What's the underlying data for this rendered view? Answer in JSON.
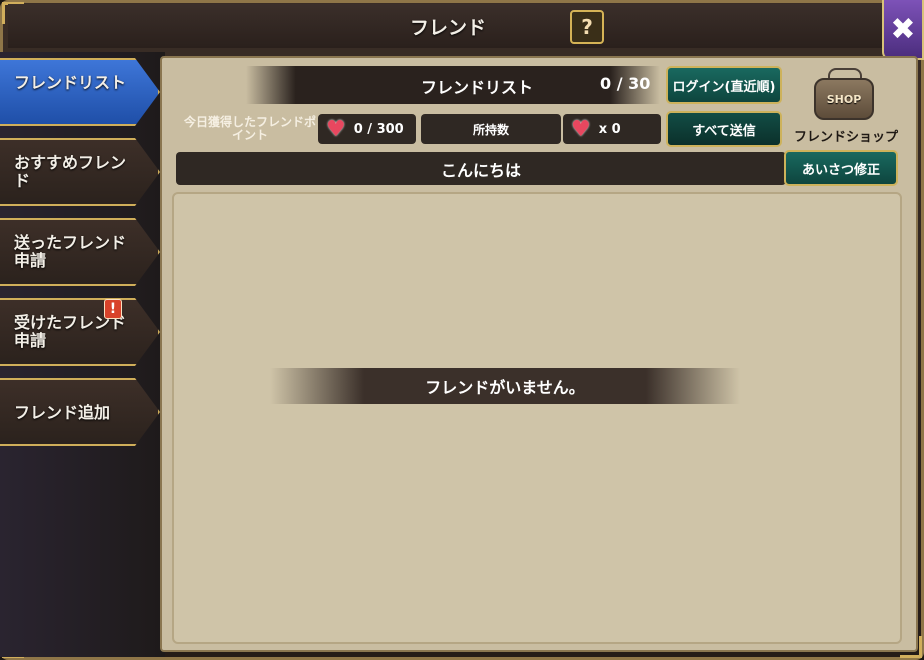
{
  "header": {
    "title": "フレンド",
    "help_label": "?",
    "close_label": "✖"
  },
  "sidebar": {
    "tabs": [
      {
        "label": "フレンドリスト",
        "active": true
      },
      {
        "label": "おすすめフレンド",
        "active": false
      },
      {
        "label": "送ったフレンド申請",
        "active": false
      },
      {
        "label": "受けたフレンド申請",
        "active": false,
        "alert": "!"
      },
      {
        "label": "フレンド追加",
        "active": false
      }
    ]
  },
  "friend_list": {
    "title": "フレンドリスト",
    "count": "0 / 30"
  },
  "buttons": {
    "login_sort": "ログイン(直近順)",
    "send_all": "すべて送信",
    "edit_greeting": "あいさつ修正"
  },
  "shop": {
    "sign_text": "SHOP",
    "label": "フレンドショップ"
  },
  "points": {
    "today_label": "今日獲得したフレンドポイント",
    "today_value": "0 / 300",
    "owned_label": "所持数",
    "owned_value": "x 0"
  },
  "greeting": {
    "text": "こんにちは"
  },
  "empty_message": "フレンドがいません。",
  "colors": {
    "active_tab": "#2f63c8",
    "teal_button": "#156157",
    "gold_border": "#cfae5a",
    "heart": "#e8475f"
  }
}
